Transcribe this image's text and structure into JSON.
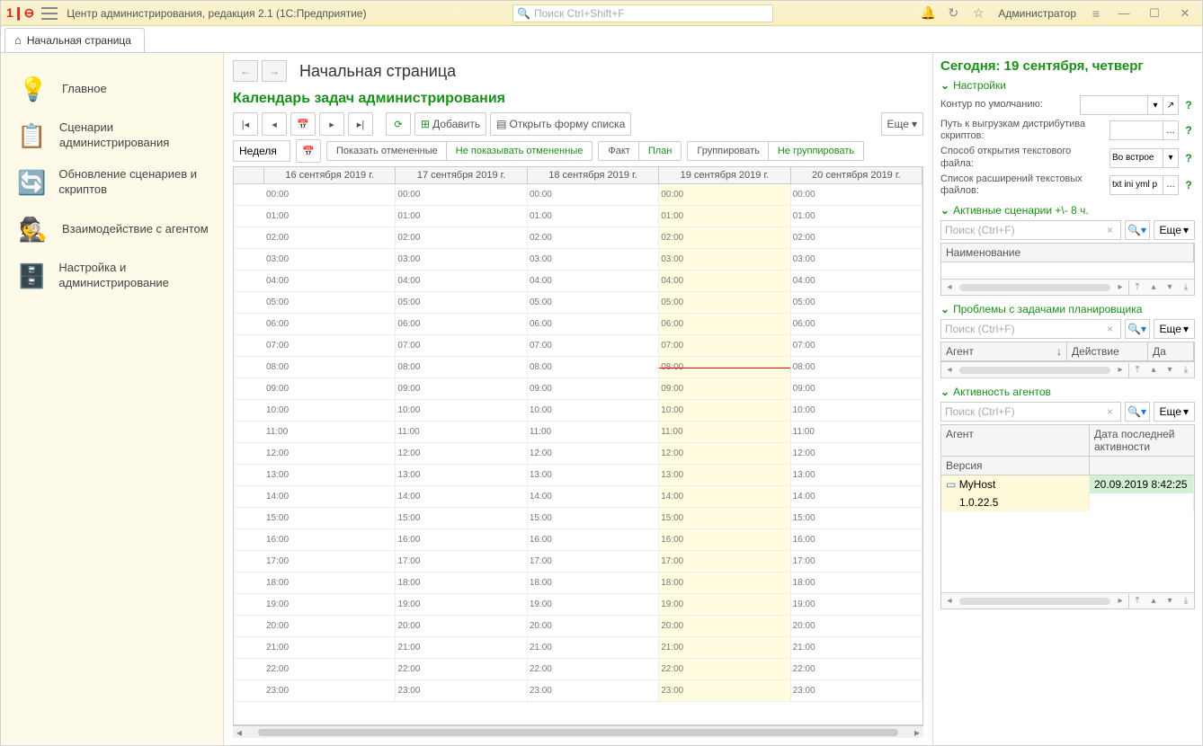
{
  "titlebar": {
    "title": "Центр администрирования, редакция 2.1  (1С:Предприятие)",
    "search_placeholder": "Поиск Ctrl+Shift+F",
    "user": "Администратор"
  },
  "tab": {
    "label": "Начальная страница"
  },
  "sidebar": {
    "items": [
      {
        "label": "Главное",
        "icon": "📘"
      },
      {
        "label": "Сценарии администрирования",
        "icon": "📋"
      },
      {
        "label": "Обновление сценариев и скриптов",
        "icon": "🔄"
      },
      {
        "label": "Взаимодействие с агентом",
        "icon": "🕵️"
      },
      {
        "label": "Настройка и администрирование",
        "icon": "💾"
      }
    ]
  },
  "page": {
    "title": "Начальная страница"
  },
  "calendar": {
    "title": "Календарь задач администрирования",
    "add_btn": "Добавить",
    "open_list_btn": "Открыть форму списка",
    "more_btn": "Еще",
    "period_label": "Неделя",
    "show_cancelled": "Показать отмененные",
    "hide_cancelled": "Не показывать отмененные",
    "fact": "Факт",
    "plan": "План",
    "group": "Группировать",
    "no_group": "Не группировать",
    "days": [
      "16 сентября 2019 г.",
      "17 сентября 2019 г.",
      "18 сентября 2019 г.",
      "19 сентября 2019 г.",
      "20 сентября 2019 г."
    ],
    "hours": [
      "00:00",
      "01:00",
      "02:00",
      "03:00",
      "04:00",
      "05:00",
      "06:00",
      "07:00",
      "08:00",
      "09:00",
      "10:00",
      "11:00",
      "12:00",
      "13:00",
      "14:00",
      "15:00",
      "16:00",
      "17:00",
      "18:00",
      "19:00",
      "20:00",
      "21:00",
      "22:00",
      "23:00"
    ]
  },
  "right": {
    "today_title": "Сегодня: 19 сентября, четверг",
    "settings": {
      "title": "Настройки",
      "contour_label": "Контур по умолчанию:",
      "distrib_path_label": "Путь к выгрузкам дистрибутива скриптов:",
      "editor_label": "Способ открытия текстового файла:",
      "editor_value": "Во встрое",
      "extensions_label": "Список расширений текстовых файлов:",
      "extensions_value": "txt ini yml p"
    },
    "scenarios": {
      "title": "Активные сценарии +\\- 8 ч.",
      "search_placeholder": "Поиск (Ctrl+F)",
      "more": "Еще",
      "col_name": "Наименование"
    },
    "problems": {
      "title": "Проблемы с задачами планировщика",
      "search_placeholder": "Поиск (Ctrl+F)",
      "more": "Еще",
      "col_agent": "Агент",
      "col_action": "Действие",
      "col_date": "Да"
    },
    "agents": {
      "title": "Активность агентов",
      "search_placeholder": "Поиск (Ctrl+F)",
      "more": "Еще",
      "col_agent": "Агент",
      "col_version": "Версия",
      "col_last": "Дата последней активности",
      "row_host": "MyHost",
      "row_version": "1.0.22.5",
      "row_last": "20.09.2019 8:42:25"
    }
  }
}
